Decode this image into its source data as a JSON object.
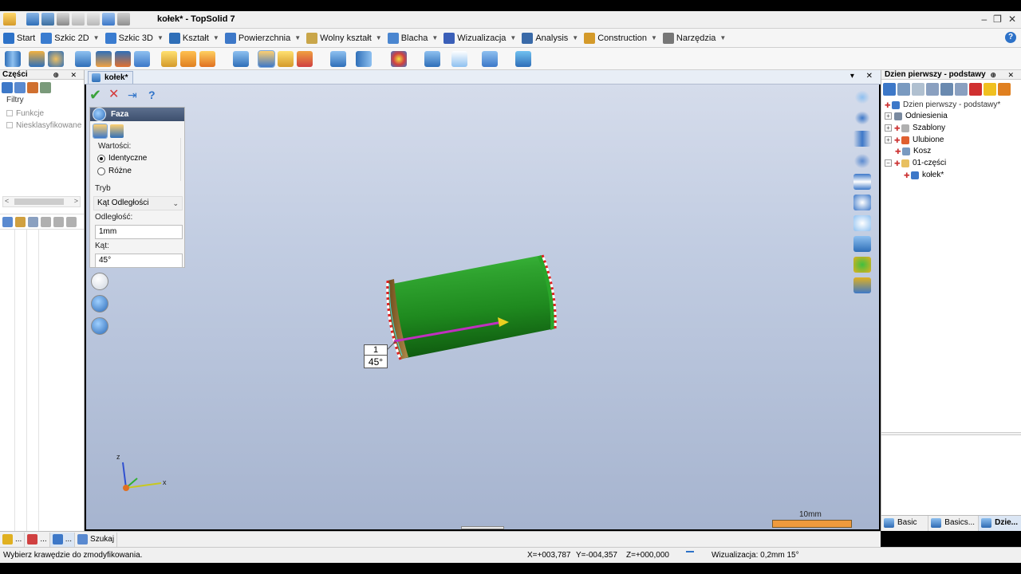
{
  "app": {
    "title": "kołek* - TopSolid 7",
    "help_glyph": "?"
  },
  "window_controls": {
    "minimize": "–",
    "restore": "❐",
    "close": "✕"
  },
  "menu": {
    "tabs": [
      {
        "label": "Start",
        "icon": "home-icon",
        "color": "#2d72c8"
      },
      {
        "label": "Szkic 2D",
        "icon": "sketch-2d-icon",
        "color": "#3a7cd0"
      },
      {
        "label": "Szkic 3D",
        "icon": "sketch-3d-icon",
        "color": "#3a7cd0"
      },
      {
        "label": "Kształt",
        "icon": "shape-icon",
        "color": "#2f6fb8"
      },
      {
        "label": "Powierzchnia",
        "icon": "surface-icon",
        "color": "#3d78c8"
      },
      {
        "label": "Wolny kształt",
        "icon": "free-shape-icon",
        "color": "#c9a64a"
      },
      {
        "label": "Blacha",
        "icon": "sheet-metal-icon",
        "color": "#4a86d0"
      },
      {
        "label": "Wizualizacja",
        "icon": "visualization-icon",
        "color": "#3a5fb8"
      },
      {
        "label": "Analysis",
        "icon": "analysis-icon",
        "color": "#3a6aa8"
      },
      {
        "label": "Construction",
        "icon": "construction-icon",
        "color": "#d49a2a"
      },
      {
        "label": "Narzędzia",
        "icon": "tools-icon",
        "color": "#777777"
      }
    ]
  },
  "document_tab": {
    "label": "kołek*",
    "controls": "▾ ✕"
  },
  "left_panel": {
    "title": "Części",
    "controls": "⊕ ✕",
    "filters_label": "Filtry",
    "entries": [
      "Funkcje",
      "Niesklasyfikowane"
    ],
    "scroll_left": "<",
    "scroll_right": ">"
  },
  "command": {
    "ok": "✔",
    "cancel": "✕",
    "pin": "⇥",
    "help": "?",
    "title": "Faza",
    "values_label": "Wartości:",
    "radio_identical": "Identyczne",
    "radio_different": "Różne",
    "mode_label": "Tryb",
    "mode_value": "Kąt Odległości",
    "mode_arrow": "⌄",
    "distance_label": "Odległość:",
    "distance_value": "1mm",
    "angle_label": "Kąt:",
    "angle_value": "45°"
  },
  "viewport": {
    "dimension_index": "1",
    "dimension_angle": "45°",
    "triad_x": "x",
    "triad_z": "z",
    "scale_label": "10mm"
  },
  "right_panel": {
    "title": "Dzien pierwszy - podstawy",
    "controls": "⊕ ✕",
    "tree": [
      {
        "label": "Dzien pierwszy - podstawy*",
        "expander": ""
      },
      {
        "label": "Odniesienia",
        "expander": "+"
      },
      {
        "label": "Szablony",
        "expander": "+"
      },
      {
        "label": "Ulubione",
        "expander": "+"
      },
      {
        "label": "Kosz",
        "expander": ""
      },
      {
        "label": "01-części",
        "expander": "−"
      },
      {
        "label": "kołek*",
        "expander": ""
      }
    ],
    "bottom_tabs": [
      "Basic ...",
      "Basics...",
      "Dzie..."
    ]
  },
  "left_bottom_tabs": [
    "...",
    "...",
    "...",
    "Szukaj"
  ],
  "status": {
    "message": "Wybierz krawędzie do zmodyfikowania.",
    "x": "X=+003,787",
    "y": "Y=-004,357",
    "z": "Z=+000,000",
    "visualization": "Wizualizacja: 0,2mm 15°"
  },
  "colors": {
    "accent": "#2d72c8",
    "part_green": "#1f8f1f",
    "chamfer_face": "#8a6a2a",
    "edge_red": "#e02020",
    "arrow_magenta": "#c030c0",
    "scale_orange": "#ef9a3c"
  }
}
